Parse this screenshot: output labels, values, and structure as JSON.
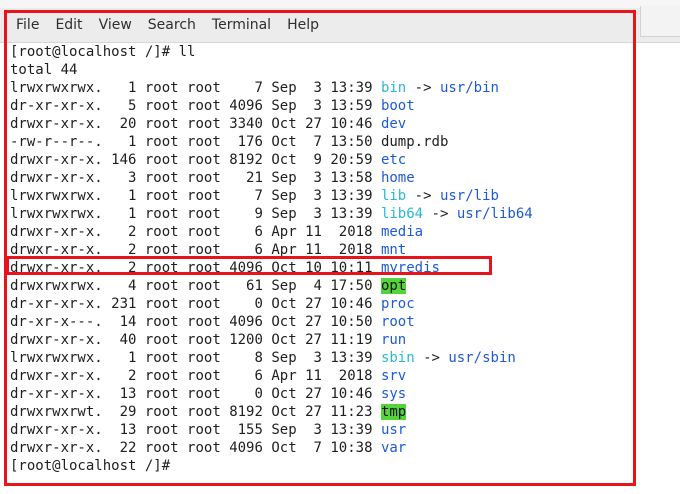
{
  "menu": [
    "File",
    "Edit",
    "View",
    "Search",
    "Terminal",
    "Help"
  ],
  "colors": {
    "directory": "#1e5ad6",
    "symlink": "#2ab8d0",
    "sticky_highlight": "#55d43a",
    "annotation_box": "#e8141c"
  },
  "terminal": {
    "prompt_line": "[root@localhost /]# ll",
    "total_line": "total 44",
    "end_prompt": "[root@localhost /]#",
    "entries": [
      {
        "perm": "lrwxrwxrwx.",
        "links": "1",
        "owner": "root",
        "group": "root",
        "size": "7",
        "mon": "Sep",
        "day": "3",
        "time": "13:39",
        "name": "bin",
        "type": "link",
        "target": "usr/bin"
      },
      {
        "perm": "dr-xr-xr-x.",
        "links": "5",
        "owner": "root",
        "group": "root",
        "size": "4096",
        "mon": "Sep",
        "day": "3",
        "time": "13:59",
        "name": "boot",
        "type": "dir"
      },
      {
        "perm": "drwxr-xr-x.",
        "links": "20",
        "owner": "root",
        "group": "root",
        "size": "3340",
        "mon": "Oct",
        "day": "27",
        "time": "10:46",
        "name": "dev",
        "type": "dir"
      },
      {
        "perm": "-rw-r--r--.",
        "links": "1",
        "owner": "root",
        "group": "root",
        "size": "176",
        "mon": "Oct",
        "day": "7",
        "time": "13:50",
        "name": "dump.rdb",
        "type": "file"
      },
      {
        "perm": "drwxr-xr-x.",
        "links": "146",
        "owner": "root",
        "group": "root",
        "size": "8192",
        "mon": "Oct",
        "day": "9",
        "time": "20:59",
        "name": "etc",
        "type": "dir"
      },
      {
        "perm": "drwxr-xr-x.",
        "links": "3",
        "owner": "root",
        "group": "root",
        "size": "21",
        "mon": "Sep",
        "day": "3",
        "time": "13:58",
        "name": "home",
        "type": "dir"
      },
      {
        "perm": "lrwxrwxrwx.",
        "links": "1",
        "owner": "root",
        "group": "root",
        "size": "7",
        "mon": "Sep",
        "day": "3",
        "time": "13:39",
        "name": "lib",
        "type": "link",
        "target": "usr/lib"
      },
      {
        "perm": "lrwxrwxrwx.",
        "links": "1",
        "owner": "root",
        "group": "root",
        "size": "9",
        "mon": "Sep",
        "day": "3",
        "time": "13:39",
        "name": "lib64",
        "type": "link",
        "target": "usr/lib64"
      },
      {
        "perm": "drwxr-xr-x.",
        "links": "2",
        "owner": "root",
        "group": "root",
        "size": "6",
        "mon": "Apr",
        "day": "11",
        "time": "2018",
        "name": "media",
        "type": "dir"
      },
      {
        "perm": "drwxr-xr-x.",
        "links": "2",
        "owner": "root",
        "group": "root",
        "size": "6",
        "mon": "Apr",
        "day": "11",
        "time": "2018",
        "name": "mnt",
        "type": "dir"
      },
      {
        "perm": "drwxr-xr-x.",
        "links": "2",
        "owner": "root",
        "group": "root",
        "size": "4096",
        "mon": "Oct",
        "day": "10",
        "time": "10:11",
        "name": "myredis",
        "type": "dir"
      },
      {
        "perm": "drwxrwxrwx.",
        "links": "4",
        "owner": "root",
        "group": "root",
        "size": "61",
        "mon": "Sep",
        "day": "4",
        "time": "17:50",
        "name": "opt",
        "type": "sticky"
      },
      {
        "perm": "dr-xr-xr-x.",
        "links": "231",
        "owner": "root",
        "group": "root",
        "size": "0",
        "mon": "Oct",
        "day": "27",
        "time": "10:46",
        "name": "proc",
        "type": "dir"
      },
      {
        "perm": "dr-xr-x---.",
        "links": "14",
        "owner": "root",
        "group": "root",
        "size": "4096",
        "mon": "Oct",
        "day": "27",
        "time": "10:50",
        "name": "root",
        "type": "dir"
      },
      {
        "perm": "drwxr-xr-x.",
        "links": "40",
        "owner": "root",
        "group": "root",
        "size": "1200",
        "mon": "Oct",
        "day": "27",
        "time": "11:19",
        "name": "run",
        "type": "dir"
      },
      {
        "perm": "lrwxrwxrwx.",
        "links": "1",
        "owner": "root",
        "group": "root",
        "size": "8",
        "mon": "Sep",
        "day": "3",
        "time": "13:39",
        "name": "sbin",
        "type": "link",
        "target": "usr/sbin"
      },
      {
        "perm": "drwxr-xr-x.",
        "links": "2",
        "owner": "root",
        "group": "root",
        "size": "6",
        "mon": "Apr",
        "day": "11",
        "time": "2018",
        "name": "srv",
        "type": "dir"
      },
      {
        "perm": "dr-xr-xr-x.",
        "links": "13",
        "owner": "root",
        "group": "root",
        "size": "0",
        "mon": "Oct",
        "day": "27",
        "time": "10:46",
        "name": "sys",
        "type": "dir"
      },
      {
        "perm": "drwxrwxrwt.",
        "links": "29",
        "owner": "root",
        "group": "root",
        "size": "8192",
        "mon": "Oct",
        "day": "27",
        "time": "11:23",
        "name": "tmp",
        "type": "sticky"
      },
      {
        "perm": "drwxr-xr-x.",
        "links": "13",
        "owner": "root",
        "group": "root",
        "size": "155",
        "mon": "Sep",
        "day": "3",
        "time": "13:39",
        "name": "usr",
        "type": "dir"
      },
      {
        "perm": "drwxr-xr-x.",
        "links": "22",
        "owner": "root",
        "group": "root",
        "size": "4096",
        "mon": "Oct",
        "day": "7",
        "time": "10:38",
        "name": "var",
        "type": "dir"
      }
    ]
  }
}
